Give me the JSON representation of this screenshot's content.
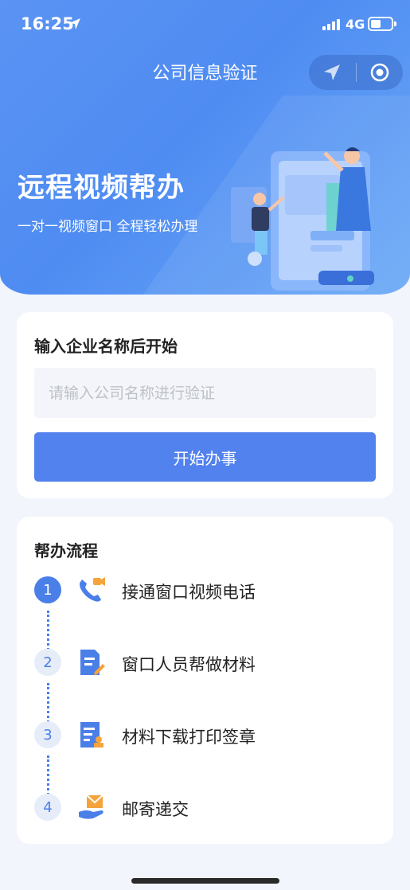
{
  "status_bar": {
    "time": "16:25",
    "network": "4G"
  },
  "nav": {
    "title": "公司信息验证"
  },
  "banner": {
    "title": "远程视频帮办",
    "subtitle": "一对一视频窗口 全程轻松办理"
  },
  "start_card": {
    "title": "输入企业名称后开始",
    "input_placeholder": "请输入公司名称进行验证",
    "input_value": "",
    "button_label": "开始办事"
  },
  "process_card": {
    "title": "帮办流程",
    "steps": [
      {
        "number": "1",
        "label": "接通窗口视频电话",
        "icon": "video-phone-icon"
      },
      {
        "number": "2",
        "label": "窗口人员帮做材料",
        "icon": "document-edit-icon"
      },
      {
        "number": "3",
        "label": "材料下载打印签章",
        "icon": "document-stamp-icon"
      },
      {
        "number": "4",
        "label": "邮寄递交",
        "icon": "mail-hand-icon"
      }
    ]
  },
  "colors": {
    "primary": "#5282ee",
    "header": "#5a93f3",
    "accent_orange": "#f5a43b"
  }
}
